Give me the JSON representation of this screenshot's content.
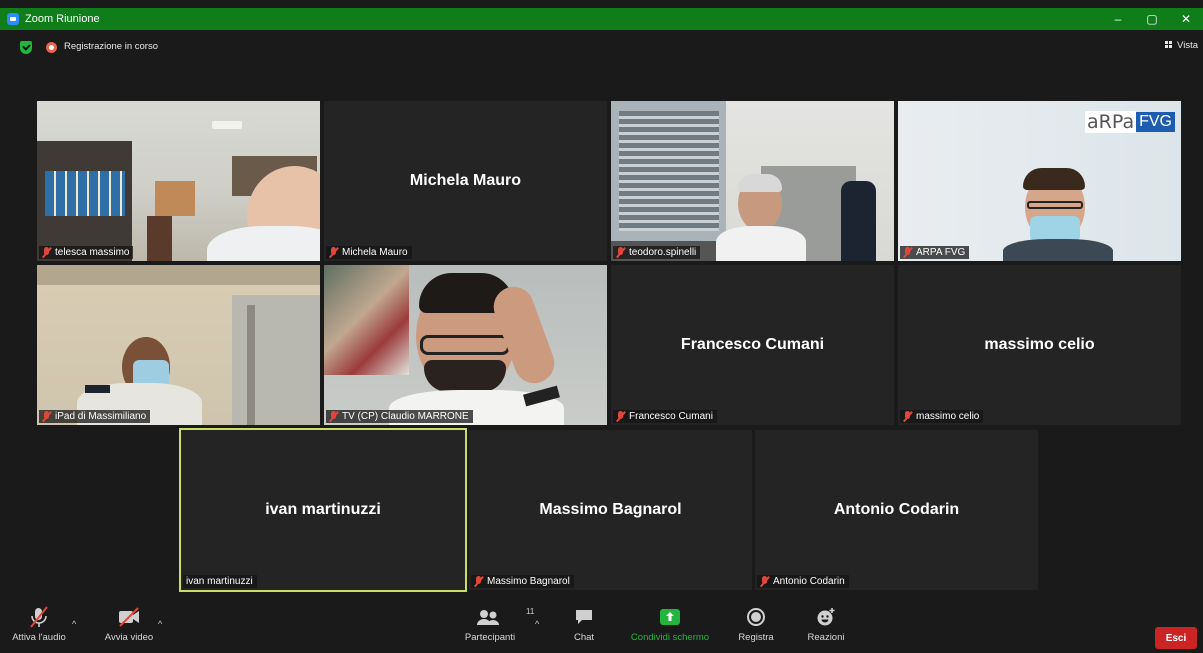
{
  "window": {
    "title": "Zoom Riunione",
    "controls": [
      "–",
      "▢",
      "✕"
    ]
  },
  "status": {
    "recording_label": "Registrazione in corso",
    "view_label": "Vista"
  },
  "participants": [
    {
      "name": "telesca massimo",
      "display": "",
      "video": true
    },
    {
      "name": "Michela Mauro",
      "display": "Michela Mauro",
      "video": false
    },
    {
      "name": "teodoro.spinelli",
      "display": "",
      "video": true
    },
    {
      "name": "ARPA FVG",
      "display": "",
      "video": true,
      "logo": [
        "aRPa",
        "FVG"
      ]
    },
    {
      "name": "iPad di Massimiliano",
      "display": "",
      "video": true
    },
    {
      "name": "TV (CP) Claudio MARRONE",
      "display": "",
      "video": true
    },
    {
      "name": "Francesco Cumani",
      "display": "Francesco Cumani",
      "video": false
    },
    {
      "name": "massimo celio",
      "display": "massimo celio",
      "video": false
    },
    {
      "name": "ivan martinuzzi",
      "display": "ivan martinuzzi",
      "video": false,
      "speaking": true
    },
    {
      "name": "Massimo Bagnarol",
      "display": "Massimo Bagnarol",
      "video": false
    },
    {
      "name": "Antonio Codarin",
      "display": "Antonio Codarin",
      "video": false
    }
  ],
  "toolbar": {
    "audio": "Attiva l'audio",
    "video": "Avvia video",
    "participants": "Partecipanti",
    "participants_count": "11",
    "chat": "Chat",
    "share": "Condividi schermo",
    "record": "Registra",
    "reactions": "Reazioni",
    "leave": "Esci"
  }
}
